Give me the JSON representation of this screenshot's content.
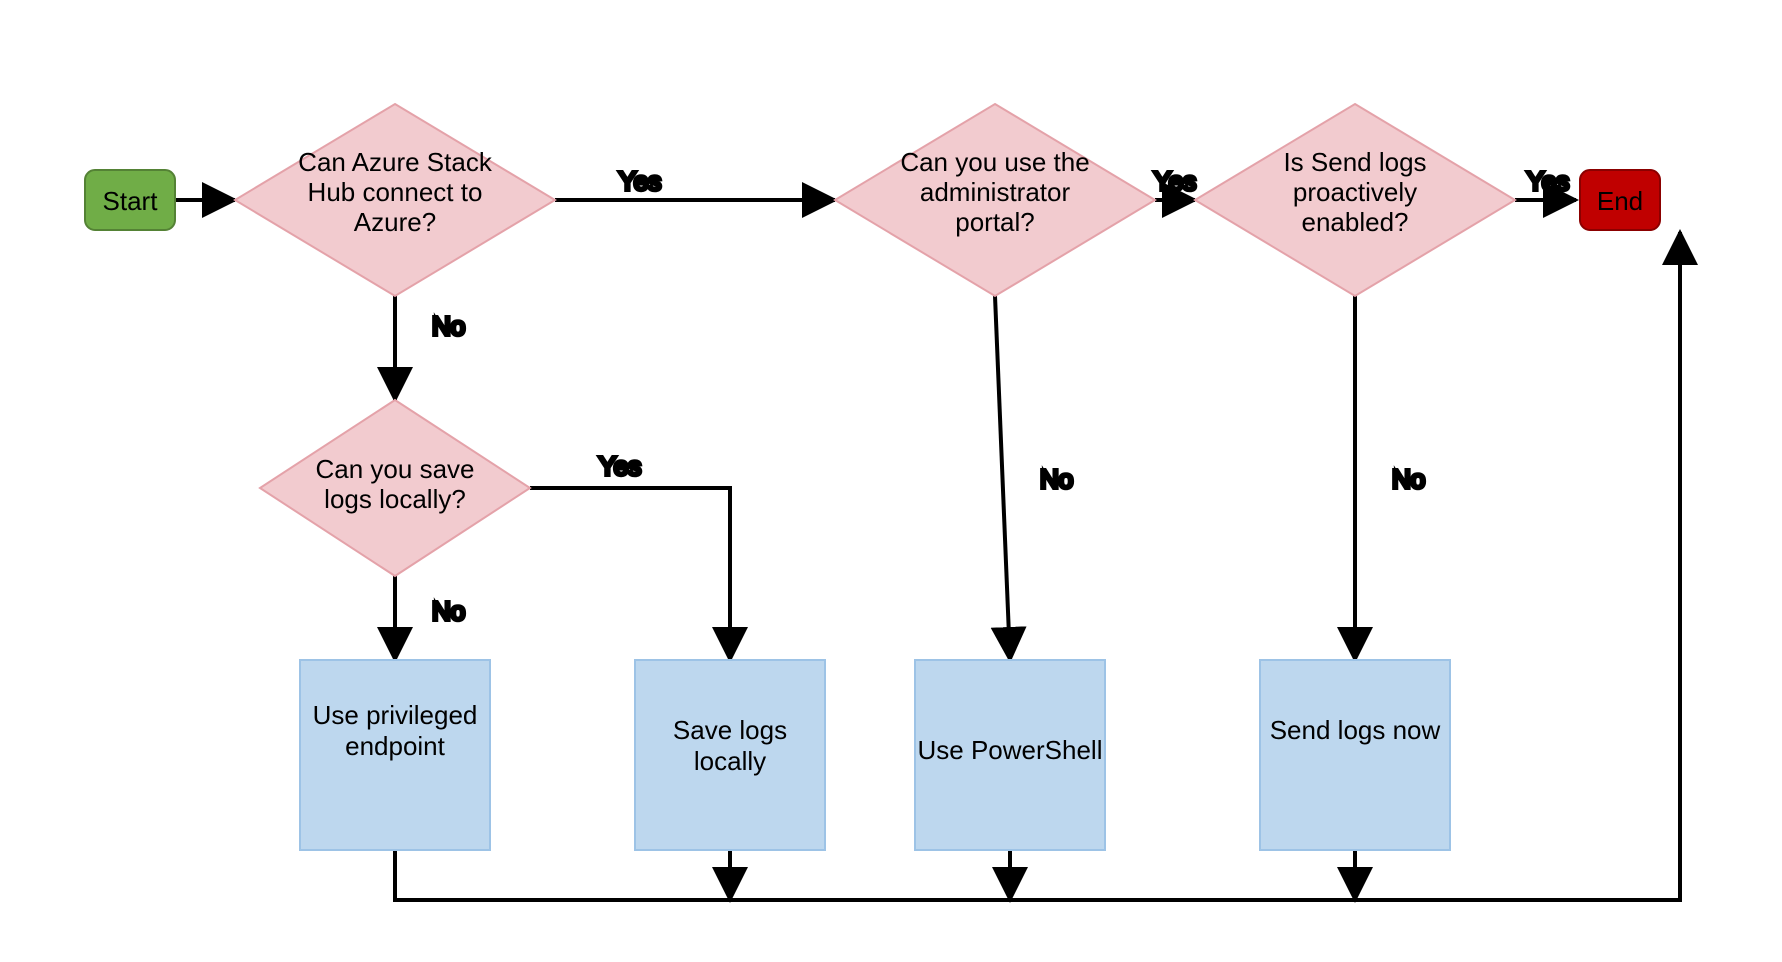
{
  "nodes": {
    "start": {
      "label": "Start"
    },
    "end": {
      "label": "End"
    },
    "d1": {
      "label": "Can Azure Stack Hub connect to Azure?"
    },
    "d2": {
      "label": "Can you use the administrator portal?"
    },
    "d3": {
      "label": "Is Send logs proactively enabled?"
    },
    "d4": {
      "label": "Can you save logs locally?"
    },
    "p1": {
      "label": "Use privileged endpoint"
    },
    "p2": {
      "label": "Save logs locally"
    },
    "p3": {
      "label": "Use PowerShell"
    },
    "p4": {
      "label": "Send logs now"
    }
  },
  "edges": {
    "d1_yes": "Yes",
    "d1_no": "No",
    "d2_yes": "Yes",
    "d2_no": "No",
    "d3_yes": "Yes",
    "d3_no": "No",
    "d4_yes": "Yes",
    "d4_no": "No"
  }
}
